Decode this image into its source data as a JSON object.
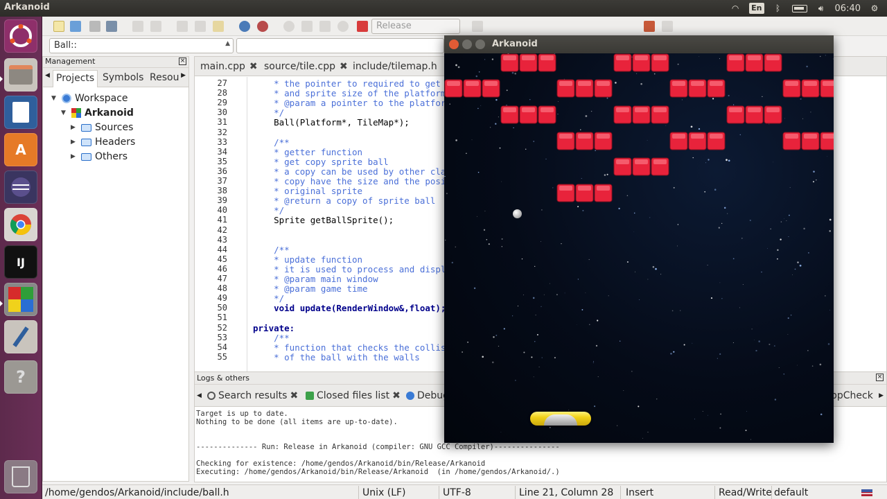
{
  "topbar": {
    "title": "Arkanoid",
    "keyboard": "En",
    "clock": "06:40"
  },
  "launcher": {
    "items": [
      "ubuntu-logo-icon",
      "file-manager-icon",
      "writer-icon",
      "software-center-icon",
      "eclipse-icon",
      "chrome-icon",
      "intellij-icon",
      "codeblocks-icon",
      "paint-brush-icon",
      "help-icon",
      "trash-icon"
    ]
  },
  "toolbar": {
    "build_target": "Release",
    "scope_combo": "Ball::"
  },
  "management": {
    "title": "Management",
    "tabs": [
      "Projects",
      "Symbols",
      "Resou"
    ],
    "tree": {
      "workspace": "Workspace",
      "project": "Arkanoid",
      "folders": [
        "Sources",
        "Headers",
        "Others"
      ]
    }
  },
  "editor": {
    "tabs": [
      "main.cpp",
      "source/tile.cpp",
      "include/tilemap.h"
    ],
    "line_numbers": [
      "27",
      "28",
      "29",
      "30",
      "31",
      "32",
      "33",
      "34",
      "35",
      "36",
      "37",
      "38",
      "39",
      "40",
      "41",
      "42",
      "43",
      "44",
      "45",
      "46",
      "47",
      "48",
      "49",
      "50",
      "51",
      "52",
      "53",
      "54",
      "55"
    ],
    "lines": [
      "    * the pointer to required to get",
      "    * and sprite size of the platform",
      "    * @param a pointer to the platfor",
      "    */",
      "    Ball(Platform*, TileMap*);",
      "",
      "    /**",
      "    * getter function",
      "    * get copy sprite ball",
      "    * a copy can be used by other cla",
      "    * copy have the size and the posi",
      "    * original sprite",
      "    * @return a copy of sprite ball",
      "    */",
      "    Sprite getBallSprite();",
      "",
      "",
      "    /**",
      "    * update function",
      "    * it is used to process and displ",
      "    * @param main window",
      "    * @param game time",
      "    */",
      "    void update(RenderWindow&,float);",
      "",
      "private:",
      "    /**",
      "    * function that checks the collis",
      "    * of the ball with the walls"
    ]
  },
  "logs": {
    "title": "Logs & others",
    "tabs": [
      "Search results",
      "Closed files list",
      "Debug",
      "ppCheck"
    ],
    "text": "Target is up to date.\nNothing to be done (all items are up-to-date).\n\n\n-------------- Run: Release in Arkanoid (compiler: GNU GCC Compiler)---------------\n\nChecking for existence: /home/gendos/Arkanoid/bin/Release/Arkanoid\nExecuting: /home/gendos/Arkanoid/bin/Release/Arkanoid  (in /home/gendos/Arkanoid/.)"
  },
  "status": {
    "path": "/home/gendos/Arkanoid/include/ball.h",
    "eol": "Unix (LF)",
    "encoding": "UTF-8",
    "position": "Line 21, Column 28",
    "mode": "Insert",
    "access": "Read/Write",
    "profile": "default"
  },
  "game": {
    "title": "Arkanoid",
    "colors": {
      "brick": "#e8233b",
      "paddle": "#f2d21a",
      "ball": "#e9e9e9"
    }
  }
}
